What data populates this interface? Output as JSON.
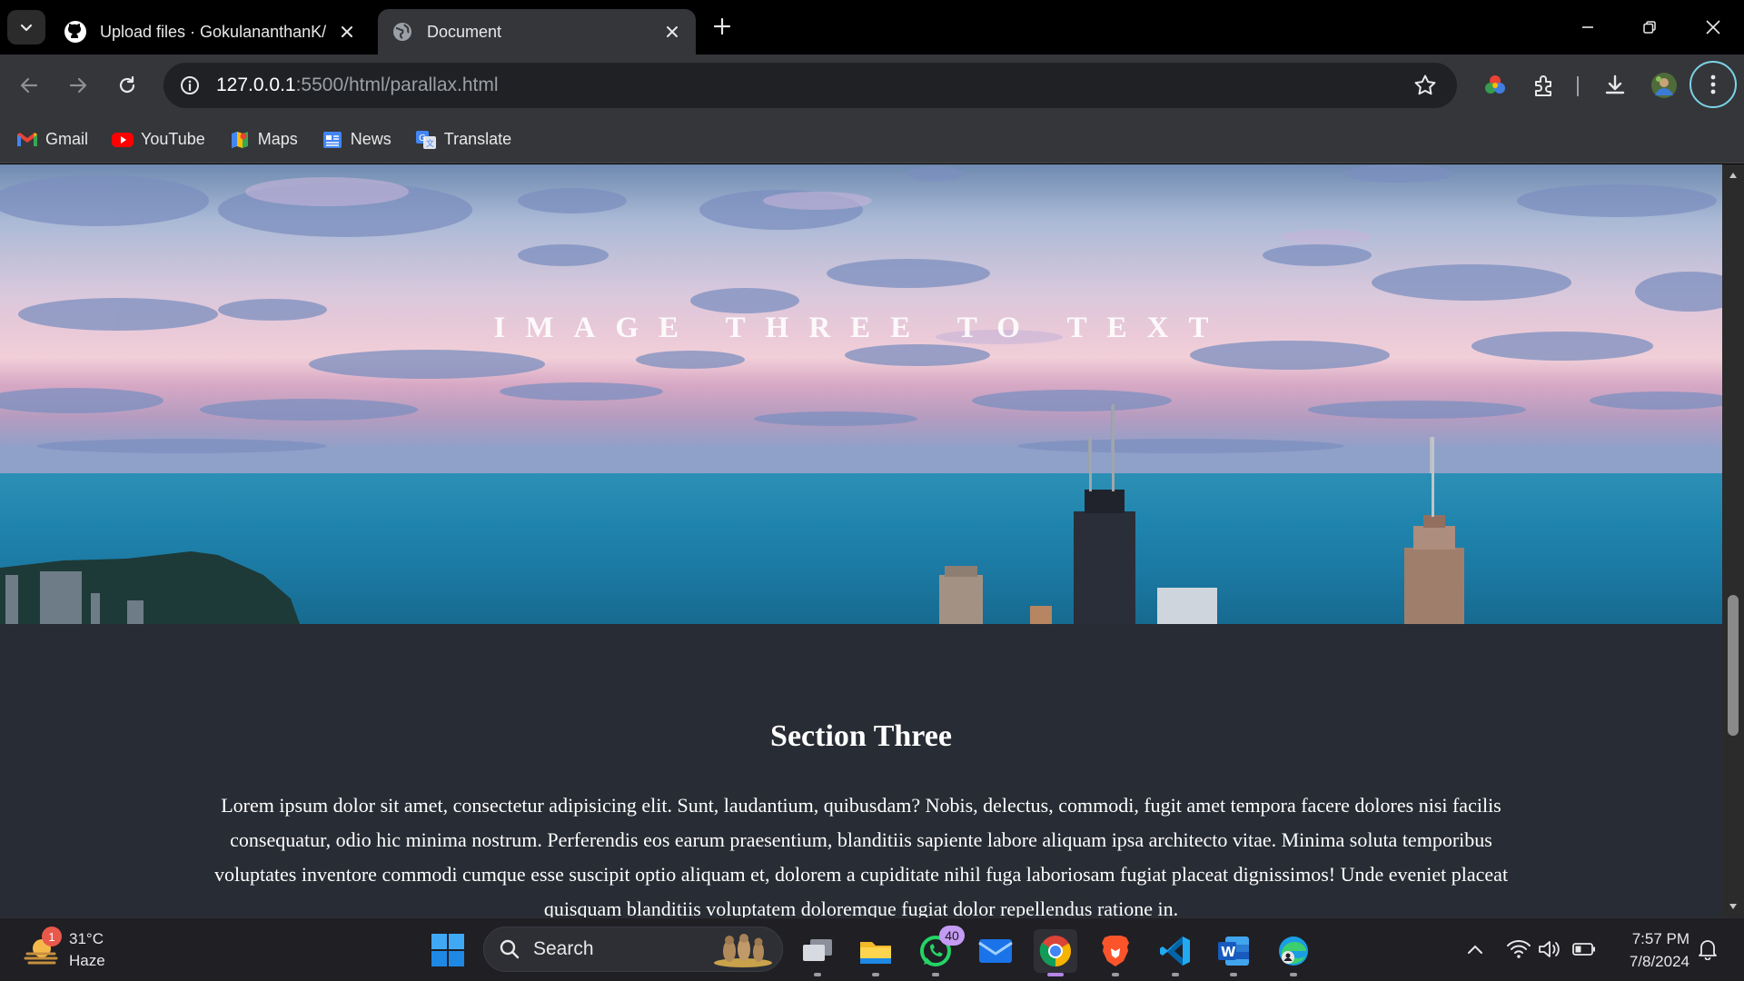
{
  "browser": {
    "tabs": [
      {
        "title": "Upload files · GokulananthanK/",
        "favicon": "github-icon",
        "active": false
      },
      {
        "title": "Document",
        "favicon": "globe-icon",
        "active": true
      }
    ],
    "url": {
      "host": "127.0.0.1",
      "rest": ":5500/html/parallax.html"
    },
    "bookmarks": [
      {
        "label": "Gmail",
        "icon": "gmail-icon"
      },
      {
        "label": "YouTube",
        "icon": "youtube-icon"
      },
      {
        "label": "Maps",
        "icon": "maps-icon"
      },
      {
        "label": "News",
        "icon": "news-icon"
      },
      {
        "label": "Translate",
        "icon": "translate-icon"
      }
    ]
  },
  "page": {
    "hero_text": "IMAGE THREE TO TEXT",
    "section_title": "Section Three",
    "section_body": "Lorem ipsum dolor sit amet, consectetur adipisicing elit. Sunt, laudantium, quibusdam? Nobis, delectus, commodi, fugit amet tempora facere dolores nisi facilis consequatur, odio hic minima nostrum. Perferendis eos earum praesentium, blanditiis sapiente labore aliquam ipsa architecto vitae. Minima soluta temporibus voluptates inventore commodi cumque esse suscipit optio aliquam et, dolorem a cupiditate nihil fuga laboriosam fugiat placeat dignissimos! Unde eveniet placeat quisquam blanditiis voluptatem doloremque fugiat dolor repellendus ratione in."
  },
  "taskbar": {
    "weather": {
      "temp": "31°C",
      "condition": "Haze",
      "badge": "1"
    },
    "search_label": "Search",
    "whatsapp_badge": "40",
    "time": "7:57 PM",
    "date": "7/8/2024"
  },
  "colors": {
    "page_bg": "#282c34",
    "taskbar_bg": "#1f1f24",
    "toolbar_bg": "#35363a",
    "accent_ring": "#7bd3e6"
  }
}
